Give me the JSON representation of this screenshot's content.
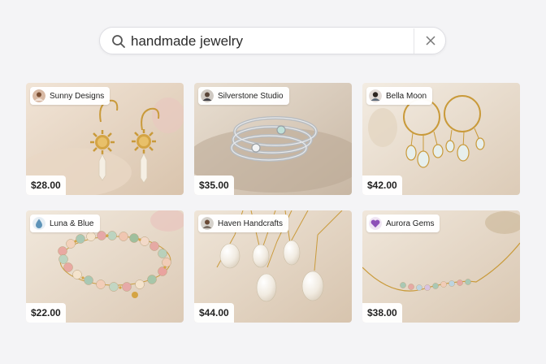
{
  "search": {
    "value": "handmade jewelry",
    "icon": "search-icon",
    "clear_icon": "close-icon"
  },
  "listings": [
    {
      "shop": "Sunny Designs",
      "price": "$28.00",
      "avatar": "person",
      "item": "gold sun earrings"
    },
    {
      "shop": "Silverstone Studio",
      "price": "$35.00",
      "avatar": "person",
      "item": "silver stacking rings"
    },
    {
      "shop": "Bella Moon",
      "price": "$42.00",
      "avatar": "person",
      "item": "gold opal hoop earrings"
    },
    {
      "shop": "Luna & Blue",
      "price": "$22.00",
      "avatar": "droplet",
      "item": "beaded bracelet"
    },
    {
      "shop": "Haven Handcrafts",
      "price": "$44.00",
      "avatar": "person",
      "item": "pearl pendant necklaces"
    },
    {
      "shop": "Aurora Gems",
      "price": "$38.00",
      "avatar": "heart",
      "item": "beaded gold chain necklace"
    }
  ],
  "colors": {
    "background": "#f4f4f6",
    "gold": "#c99a3a",
    "silver": "#b8bcc0"
  }
}
